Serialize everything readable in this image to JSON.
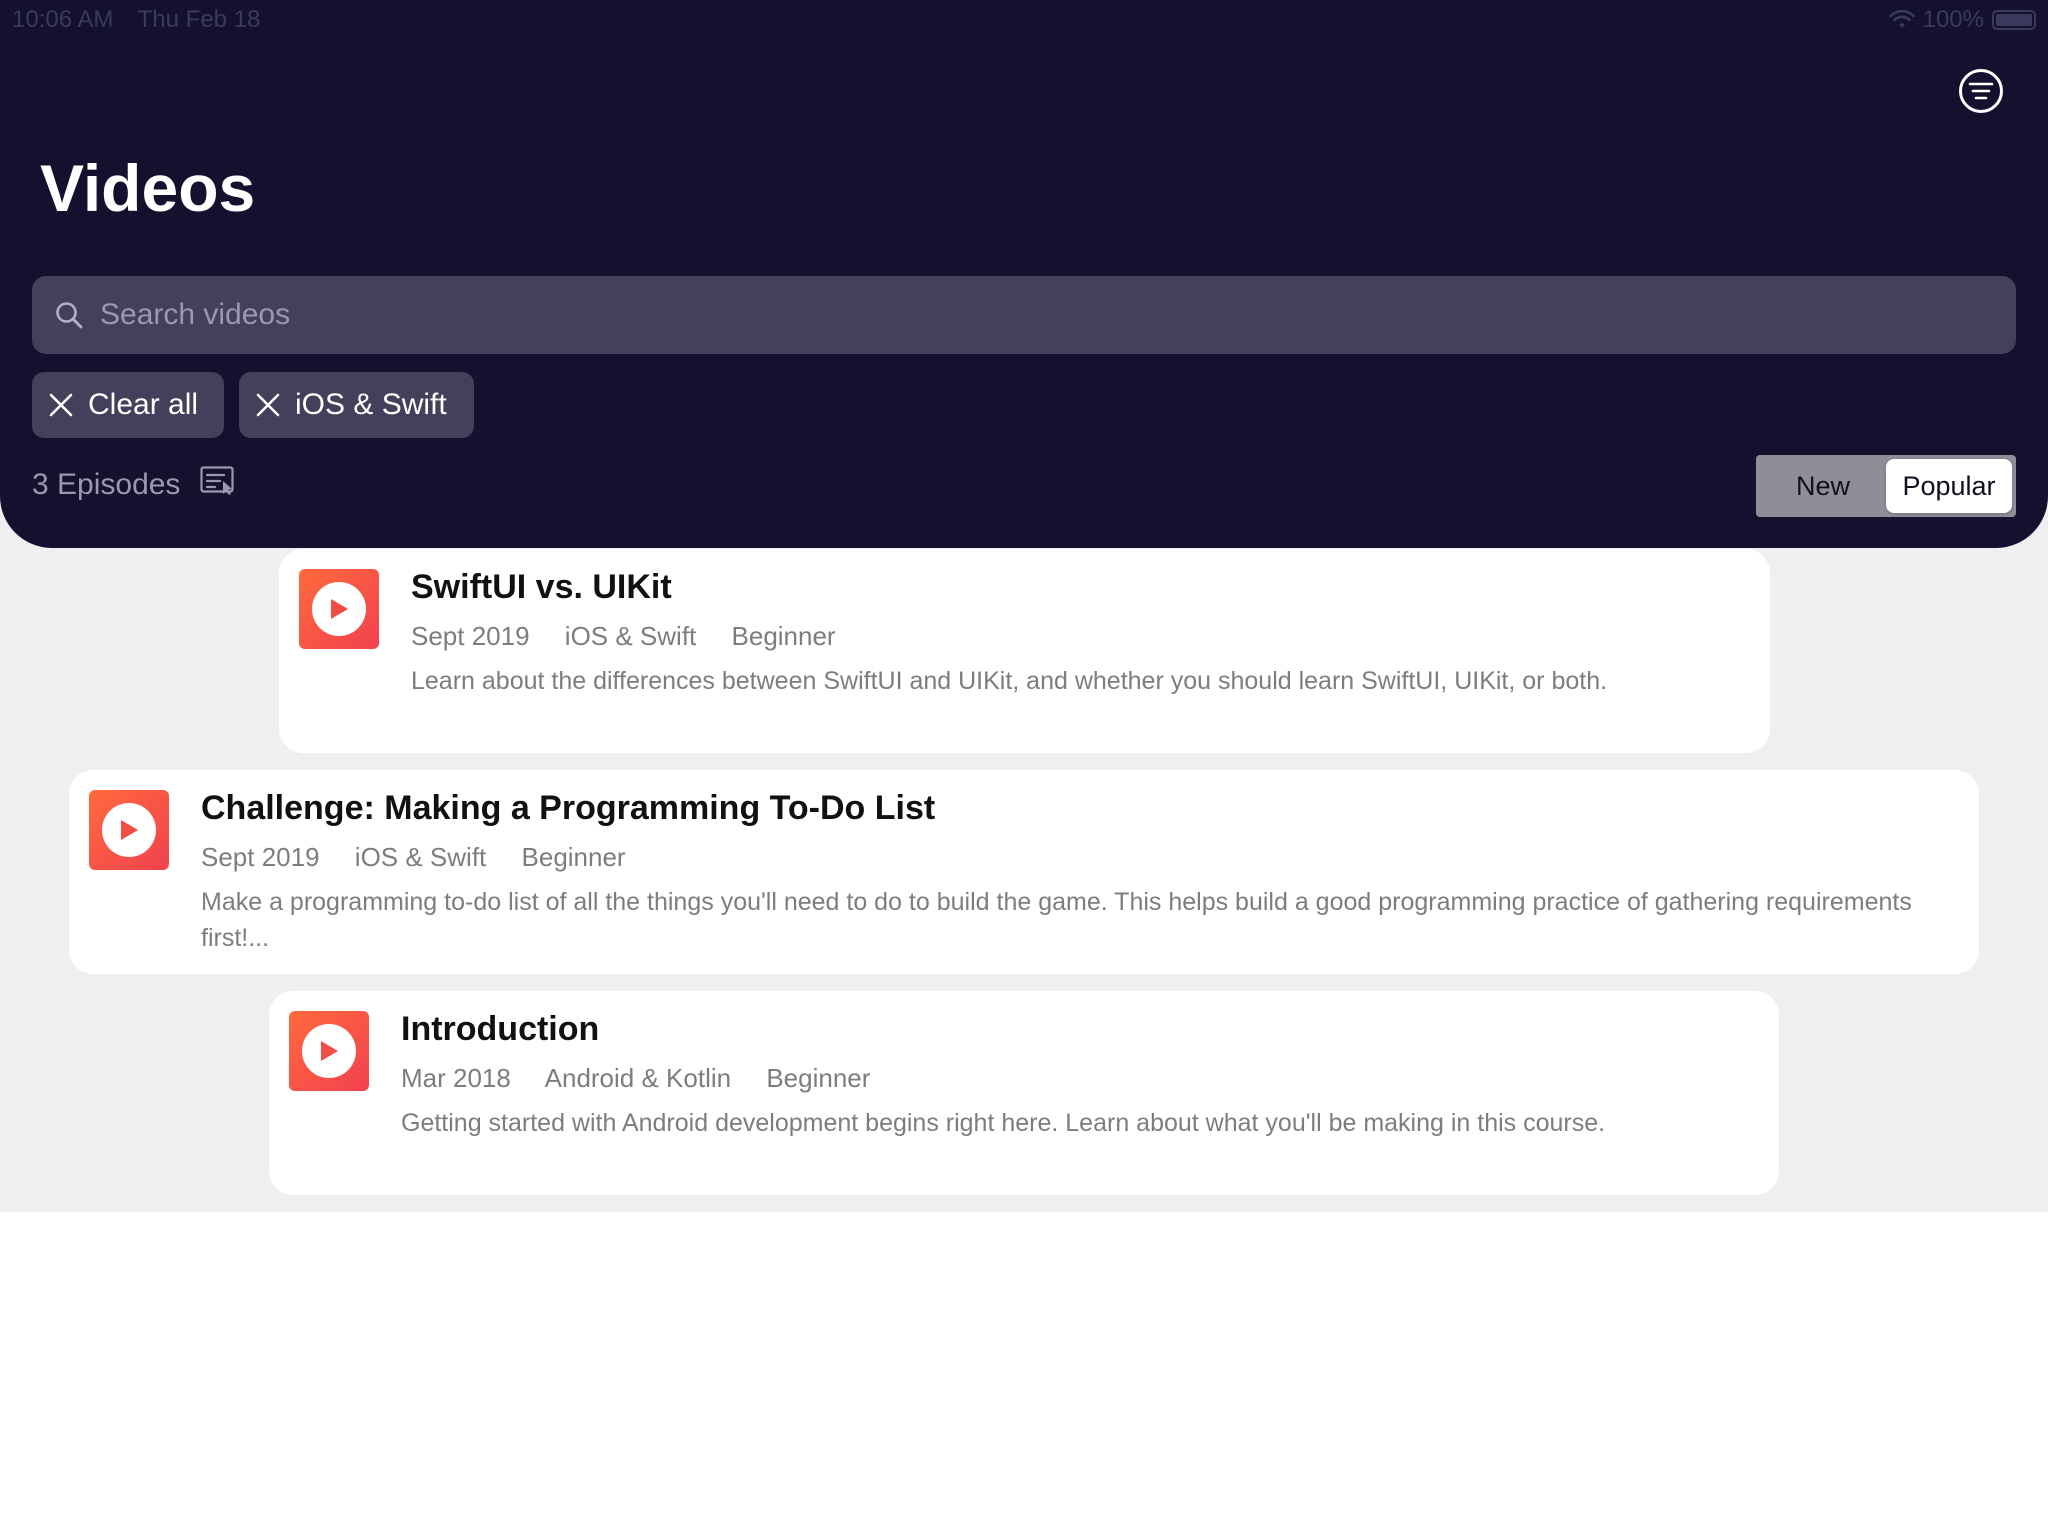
{
  "status_bar": {
    "time": "10:06 AM",
    "date": "Thu Feb 18",
    "battery": "100%"
  },
  "header": {
    "title": "Videos",
    "filter_icon": "filter-lines-circle-icon"
  },
  "search": {
    "placeholder": "Search videos",
    "value": ""
  },
  "filters": {
    "clear_all_label": "Clear all",
    "active": [
      {
        "label": "iOS & Swift"
      }
    ]
  },
  "results": {
    "count_label": "3 Episodes",
    "download_icon": "download-select-icon"
  },
  "sort": {
    "options": [
      "New",
      "Popular"
    ],
    "selected": "Popular"
  },
  "videos": [
    {
      "title": "SwiftUI vs. UIKit",
      "date": "Sept 2019",
      "platform": "iOS & Swift",
      "level": "Beginner",
      "description": "Learn about the differences between SwiftUI and UIKit, and whether you should learn SwiftUI, UIKit, or both."
    },
    {
      "title": "Challenge: Making a Programming To-Do List",
      "date": "Sept 2019",
      "platform": "iOS & Swift",
      "level": "Beginner",
      "description": "Make a programming to-do list of all the things you'll need to do to build the game. This helps build a good programming practice of gathering requirements first!..."
    },
    {
      "title": "Introduction",
      "date": "Mar 2018",
      "platform": "Android & Kotlin",
      "level": "Beginner",
      "description": "Getting started with Android development begins right here. Learn about what you'll be making in this course."
    }
  ],
  "colors": {
    "header_bg": "#13112e",
    "search_bg": "#42405a",
    "thumb_gradient_start": "#ff6a3d",
    "thumb_gradient_end": "#f2414f",
    "list_bg": "#efefef"
  }
}
